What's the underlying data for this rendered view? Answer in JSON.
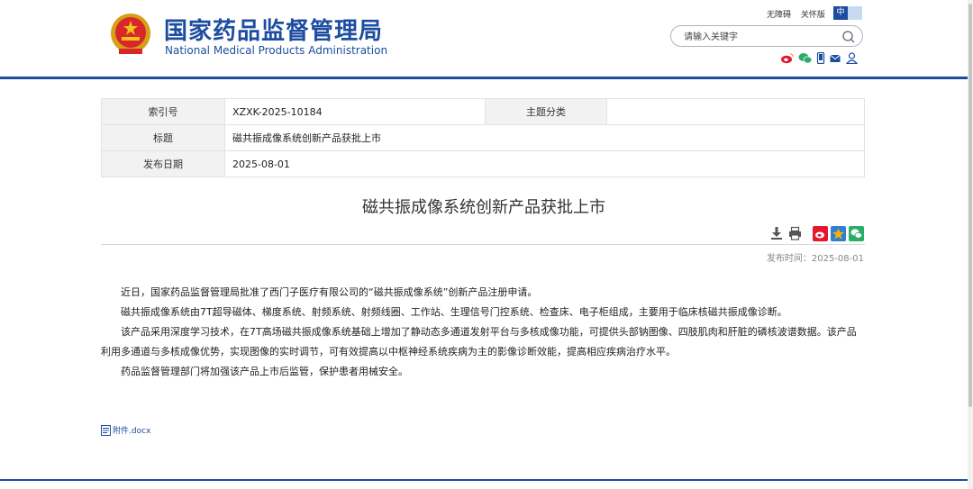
{
  "header": {
    "site_title": "国家药品监督管理局",
    "site_subtitle": "National Medical Products Administration",
    "links": {
      "accessible": "无障碍",
      "elder": "关怀版"
    },
    "lang": {
      "zh": "中",
      "en": ""
    },
    "search": {
      "placeholder": "请输入关键字",
      "value": ""
    },
    "social_icons": [
      "weibo-icon",
      "wechat-icon",
      "mobile-icon",
      "mail-icon",
      "user-icon"
    ]
  },
  "meta_table": {
    "index_label": "索引号",
    "index_value": "XZXK-2025-10184",
    "category_label": "主题分类",
    "category_value": "",
    "title_label": "标题",
    "title_value": "磁共振成像系统创新产品获批上市",
    "date_label": "发布日期",
    "date_value": "2025-08-01"
  },
  "article": {
    "title": "磁共振成像系统创新产品获批上市",
    "publish_time": "发布时间：2025-08-01",
    "paragraphs": [
      "近日，国家药品监督管理局批准了西门子医疗有限公司的“磁共振成像系统”创新产品注册申请。",
      "磁共振成像系统由7T超导磁体、梯度系统、射频系统、射频线圈、工作站、生理信号门控系统、检查床、电子柜组成，主要用于临床核磁共振成像诊断。",
      "该产品采用深度学习技术，在7T高场磁共振成像系统基础上增加了静动态多通道发射平台与多核成像功能，可提供头部钠图像、四肢肌肉和肝脏的磷核波谱数据。该产品利用多通道与多核成像优势，实现图像的实时调节，可有效提高以中枢神经系统疾病为主的影像诊断效能，提高相应疾病治疗水平。",
      "药品监督管理部门将加强该产品上市后监管，保护患者用械安全。"
    ],
    "attachment": "附件.docx"
  },
  "colors": {
    "brand_blue": "#1c4da1",
    "weibo_red": "#e6162d",
    "wechat_green": "#2aae67",
    "star_yellow": "#f5b400"
  }
}
